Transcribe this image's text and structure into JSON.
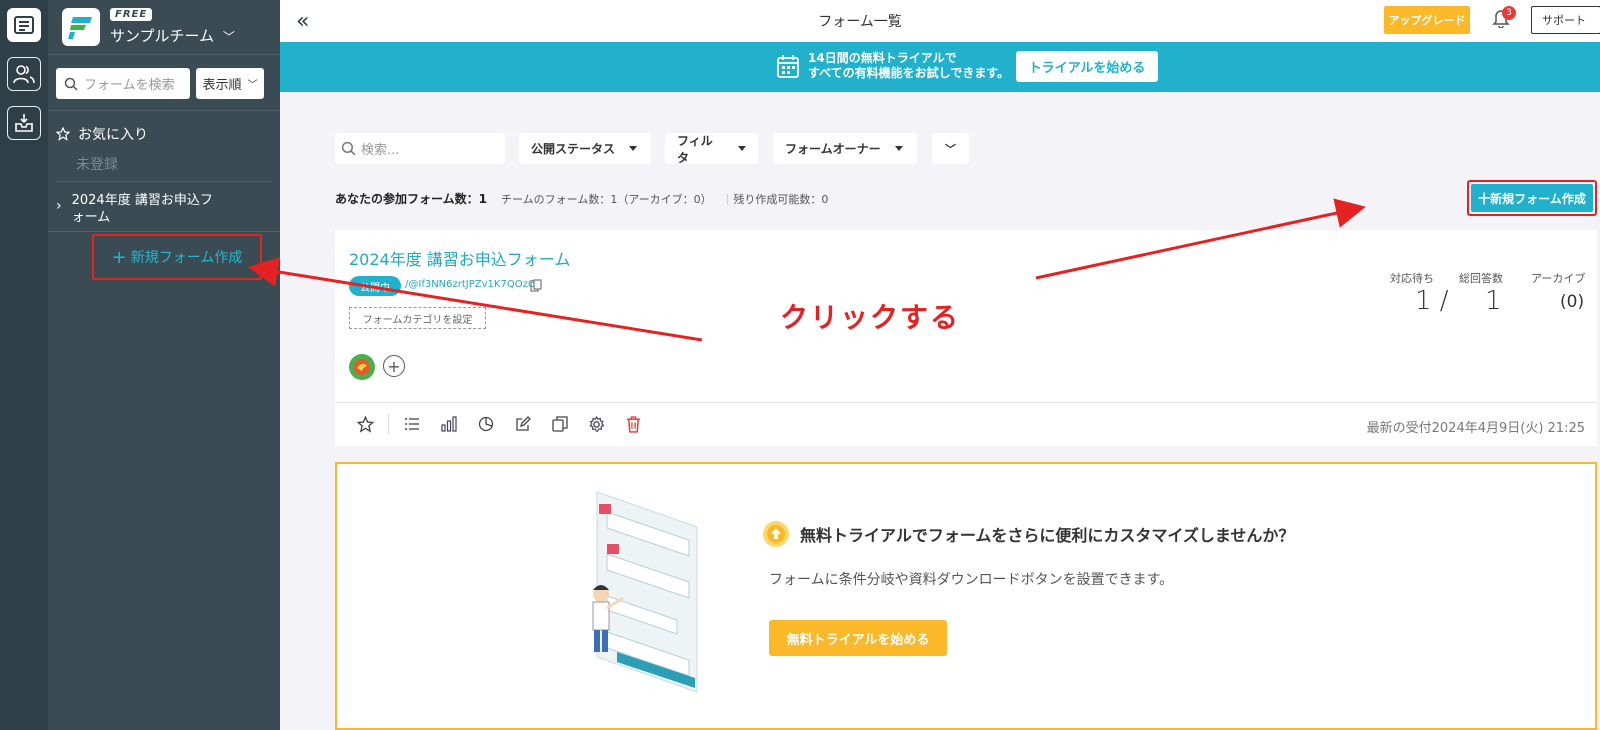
{
  "sidebar": {
    "plan_badge": "FREE",
    "team_name": "サンプルチーム",
    "search_placeholder": "フォームを検索",
    "sort_label": "表示順",
    "favorites_label": "お気に入り",
    "favorites_empty": "未登録",
    "form_item_label": "2024年度 講習お申込フォーム",
    "new_form_label": "新規フォーム作成"
  },
  "header": {
    "title": "フォーム一覧",
    "upgrade_label": "アップグレード",
    "notification_count": "3",
    "support_label": "サポート"
  },
  "banner": {
    "line1": "14日間の無料トライアルで",
    "line2": "すべての有料機能をお試しできます。",
    "button_label": "トライアルを始める"
  },
  "toolbar": {
    "search_placeholder": "検索...",
    "status_filter": "公開ステータス",
    "filter": "フィルタ",
    "owner_filter": "フォームオーナー"
  },
  "counts": {
    "joined": "あなたの参加フォーム数：1",
    "team": "チームのフォーム数：1（アーカイブ：0）",
    "remaining": "残り作成可能数：0"
  },
  "new_form_button": "十新規フォーム作成",
  "form_card": {
    "title": "2024年度 講習お申込フォーム",
    "status": "公開中",
    "url": "/@If3NN6zrtJPZv1K7QOzC",
    "category_label": "フォームカテゴリを設定",
    "pending_label": "対応待ち",
    "pending_value": "1 /",
    "total_label": "総回答数",
    "total_value": "1",
    "archive_label": "アーカイブ",
    "archive_value": "(0)",
    "latest_received": "最新の受付2024年4月9日(火) 21:25"
  },
  "promo": {
    "title": "無料トライアルでフォームをさらに便利にカスタマイズしませんか？",
    "description": "フォームに条件分岐や資料ダウンロードボタンを設置できます。",
    "button_label": "無料トライアルを始める"
  },
  "annotation": {
    "note": "クリックする"
  },
  "colors": {
    "accent": "#22b1cc",
    "sidebar": "#3b4b53",
    "rail": "#2f3f47",
    "upgrade": "#fbb829",
    "annotation": "#e52222"
  }
}
